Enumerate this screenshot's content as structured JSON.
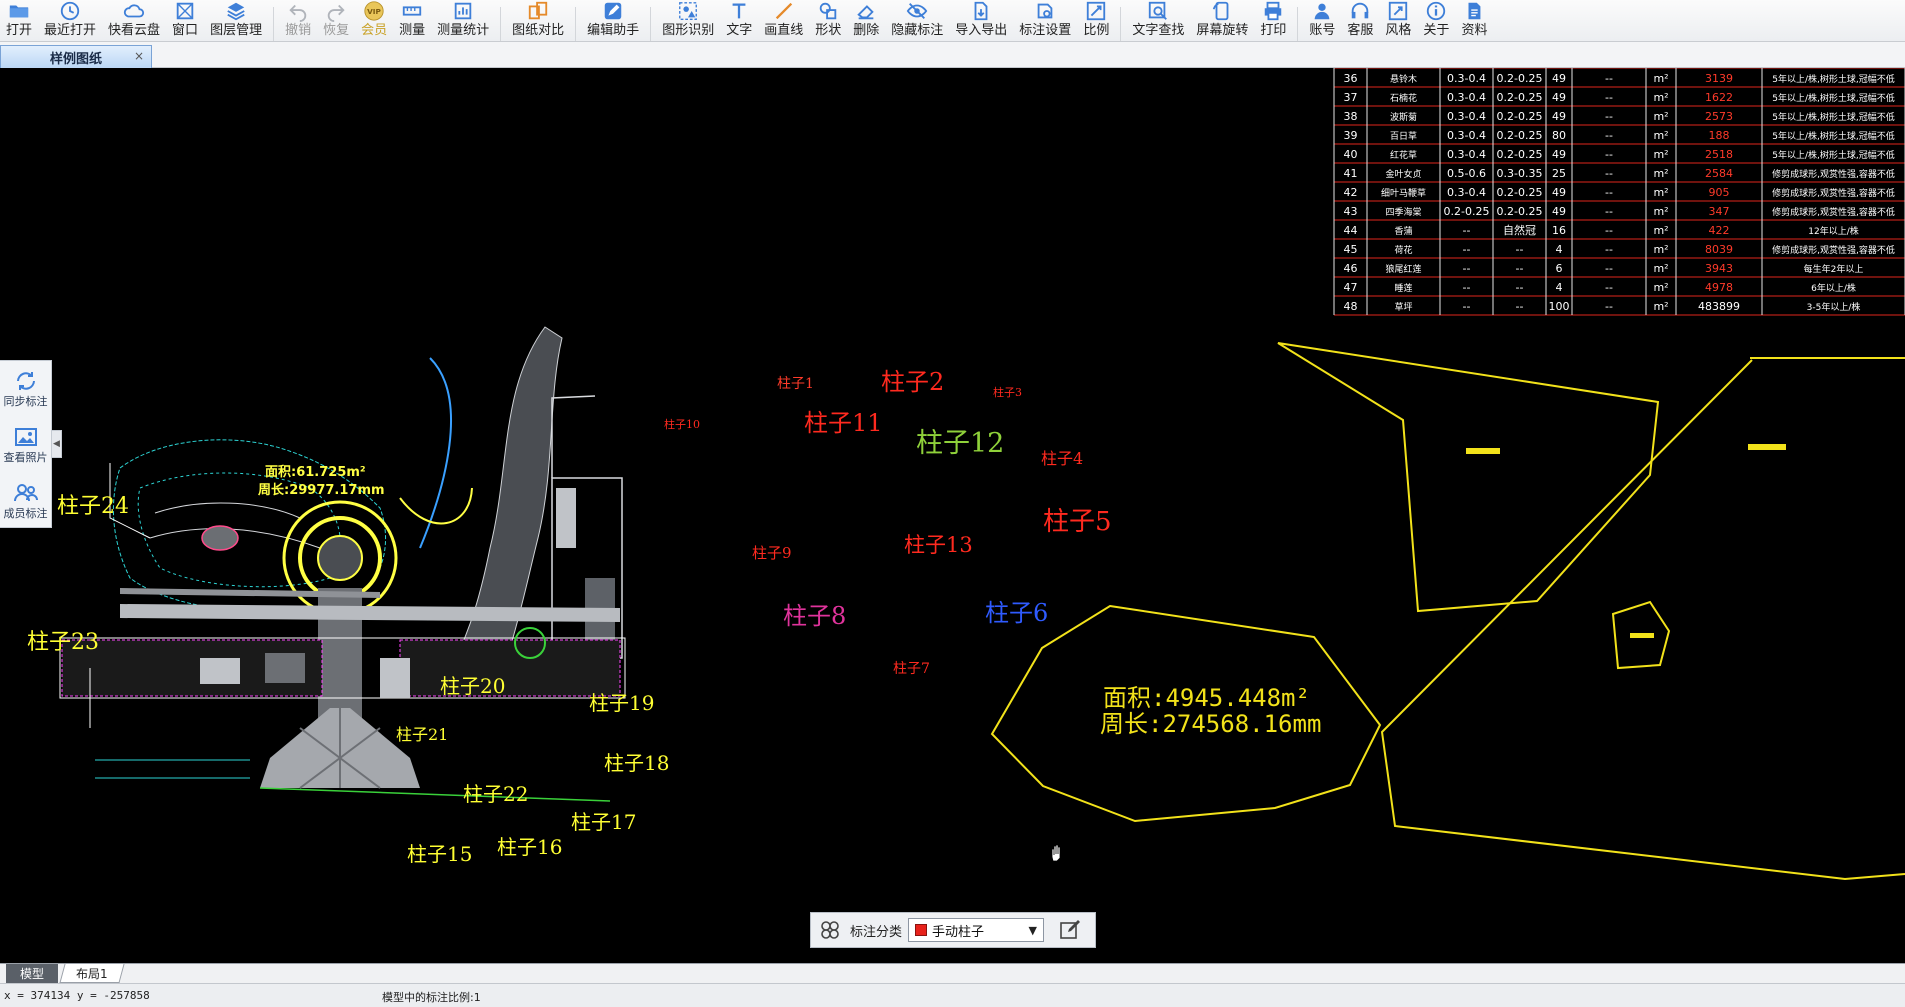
{
  "toolbar": {
    "items": [
      {
        "label": "打开",
        "icon": "folder-icon"
      },
      {
        "label": "最近打开",
        "icon": "clock-icon"
      },
      {
        "label": "快看云盘",
        "icon": "cloud-icon"
      },
      {
        "label": "窗口",
        "icon": "window-icon"
      },
      {
        "label": "图层管理",
        "icon": "layers-icon"
      },
      {
        "label": "撤销",
        "icon": "undo-icon"
      },
      {
        "label": "恢复",
        "icon": "redo-icon"
      },
      {
        "label": "会员",
        "icon": "vip-icon"
      },
      {
        "label": "测量",
        "icon": "ruler-icon"
      },
      {
        "label": "测量统计",
        "icon": "measure-stats-icon"
      },
      {
        "label": "图纸对比",
        "icon": "compare-icon"
      },
      {
        "label": "编辑助手",
        "icon": "edit-assistant-icon"
      },
      {
        "label": "图形识别",
        "icon": "shape-recognition-icon"
      },
      {
        "label": "文字",
        "icon": "text-icon"
      },
      {
        "label": "画直线",
        "icon": "line-icon"
      },
      {
        "label": "形状",
        "icon": "shape-icon"
      },
      {
        "label": "删除",
        "icon": "eraser-icon"
      },
      {
        "label": "隐藏标注",
        "icon": "eye-hide-icon"
      },
      {
        "label": "导入导出",
        "icon": "import-export-icon"
      },
      {
        "label": "标注设置",
        "icon": "annotation-settings-icon"
      },
      {
        "label": "比例",
        "icon": "scale-icon"
      },
      {
        "label": "文字查找",
        "icon": "text-search-icon"
      },
      {
        "label": "屏幕旋转",
        "icon": "rotate-screen-icon"
      },
      {
        "label": "打印",
        "icon": "printer-icon"
      },
      {
        "label": "账号",
        "icon": "user-icon"
      },
      {
        "label": "客服",
        "icon": "headset-icon"
      },
      {
        "label": "风格",
        "icon": "style-icon"
      },
      {
        "label": "关于",
        "icon": "info-icon"
      },
      {
        "label": "资料",
        "icon": "docs-icon"
      }
    ]
  },
  "document_tab": {
    "title": "样例图纸",
    "close": "×"
  },
  "side_panel": {
    "items": [
      {
        "label": "同步标注",
        "icon": "sync-icon"
      },
      {
        "label": "查看照片",
        "icon": "photo-icon"
      },
      {
        "label": "成员标注",
        "icon": "members-icon"
      }
    ],
    "collapse": "◀"
  },
  "plant_table": {
    "rows": [
      {
        "no": "36",
        "name": "悬铃木",
        "d1": "0.3-0.4",
        "d2": "0.2-0.25",
        "n": "49",
        "spec": "--",
        "unit": "m²",
        "qty": "3139",
        "note": "5年以上/株,树形土球,冠幅不低"
      },
      {
        "no": "37",
        "name": "石楠花",
        "d1": "0.3-0.4",
        "d2": "0.2-0.25",
        "n": "49",
        "spec": "--",
        "unit": "m²",
        "qty": "1622",
        "note": "5年以上/株,树形土球,冠幅不低"
      },
      {
        "no": "38",
        "name": "波斯菊",
        "d1": "0.3-0.4",
        "d2": "0.2-0.25",
        "n": "49",
        "spec": "--",
        "unit": "m²",
        "qty": "2573",
        "note": "5年以上/株,树形土球,冠幅不低"
      },
      {
        "no": "39",
        "name": "百日草",
        "d1": "0.3-0.4",
        "d2": "0.2-0.25",
        "n": "80",
        "spec": "--",
        "unit": "m²",
        "qty": "188",
        "note": "5年以上/株,树形土球,冠幅不低"
      },
      {
        "no": "40",
        "name": "红花草",
        "d1": "0.3-0.4",
        "d2": "0.2-0.25",
        "n": "49",
        "spec": "--",
        "unit": "m²",
        "qty": "2518",
        "note": "5年以上/株,树形土球,冠幅不低"
      },
      {
        "no": "41",
        "name": "金叶女贞",
        "d1": "0.5-0.6",
        "d2": "0.3-0.35",
        "n": "25",
        "spec": "--",
        "unit": "m²",
        "qty": "2584",
        "note": "修剪成球形,观赏性强,容器不低"
      },
      {
        "no": "42",
        "name": "细叶马鞭草",
        "d1": "0.3-0.4",
        "d2": "0.2-0.25",
        "n": "49",
        "spec": "--",
        "unit": "m²",
        "qty": "905",
        "note": "修剪成球形,观赏性强,容器不低"
      },
      {
        "no": "43",
        "name": "四季海棠",
        "d1": "0.2-0.25",
        "d2": "0.2-0.25",
        "n": "49",
        "spec": "--",
        "unit": "m²",
        "qty": "347",
        "note": "修剪成球形,观赏性强,容器不低"
      },
      {
        "no": "44",
        "name": "香蒲",
        "d1": "--",
        "d2": "自然冠",
        "n": "16",
        "spec": "--",
        "unit": "m²",
        "qty": "422",
        "note": "12年以上/株"
      },
      {
        "no": "45",
        "name": "荷花",
        "d1": "--",
        "d2": "--",
        "n": "4",
        "spec": "--",
        "unit": "m²",
        "qty": "8039",
        "note": "修剪成球形,观赏性强,容器不低"
      },
      {
        "no": "46",
        "name": "狼尾红莲",
        "d1": "--",
        "d2": "--",
        "n": "6",
        "spec": "--",
        "unit": "m²",
        "qty": "3943",
        "note": "每生年2年以上"
      },
      {
        "no": "47",
        "name": "睡莲",
        "d1": "--",
        "d2": "--",
        "n": "4",
        "spec": "--",
        "unit": "m²",
        "qty": "4978",
        "note": "6年以上/株"
      },
      {
        "no": "48",
        "name": "草坪",
        "d1": "--",
        "d2": "--",
        "n": "100",
        "spec": "--",
        "unit": "m²",
        "qty": "483899",
        "note": "3-5年以上/株"
      }
    ]
  },
  "column_labels": [
    {
      "text": "柱子1",
      "color": "#ff3b2a",
      "size": 14
    },
    {
      "text": "柱子2",
      "color": "#ff2a1f",
      "size": 24
    },
    {
      "text": "柱子3",
      "color": "#ff2a1f",
      "size": 11
    },
    {
      "text": "柱子4",
      "color": "#ff2a1f",
      "size": 16
    },
    {
      "text": "柱子5",
      "color": "#ff2a1f",
      "size": 26
    },
    {
      "text": "柱子6",
      "color": "#2f5bff",
      "size": 24
    },
    {
      "text": "柱子7",
      "color": "#ff2a1f",
      "size": 14
    },
    {
      "text": "柱子8",
      "color": "#e0339c",
      "size": 24
    },
    {
      "text": "柱子9",
      "color": "#ff2a1f",
      "size": 15
    },
    {
      "text": "柱子10",
      "color": "#ff2a1f",
      "size": 11
    },
    {
      "text": "柱子11",
      "color": "#ff2a1f",
      "size": 24
    },
    {
      "text": "柱子12",
      "color": "#8fd13a",
      "size": 27
    },
    {
      "text": "柱子13",
      "color": "#ff2a1f",
      "size": 21
    },
    {
      "text": "柱子24",
      "color": "#ffff33",
      "size": 22
    },
    {
      "text": "柱子23",
      "color": "#ffff33",
      "size": 22
    },
    {
      "text": "柱子20",
      "color": "#ffff33",
      "size": 20
    },
    {
      "text": "柱子19",
      "color": "#ffff33",
      "size": 20
    },
    {
      "text": "柱子21",
      "color": "#ffff33",
      "size": 16
    },
    {
      "text": "柱子18",
      "color": "#ffff33",
      "size": 20
    },
    {
      "text": "柱子22",
      "color": "#ffff33",
      "size": 20
    },
    {
      "text": "柱子17",
      "color": "#ffff33",
      "size": 20
    },
    {
      "text": "柱子15",
      "color": "#ffff33",
      "size": 20
    },
    {
      "text": "柱子16",
      "color": "#ffff33",
      "size": 20
    }
  ],
  "area_annotations": [
    {
      "area": "面积:4945.448m²",
      "perimeter": "周长:274568.16mm"
    },
    {
      "area": "面积:61.725m²",
      "perimeter": "周长:29977.17mm"
    }
  ],
  "annotation_bar": {
    "label": "标注分类",
    "selected": "手动柱子",
    "swatch_color": "#e8221b"
  },
  "layout_tabs": {
    "model": "模型",
    "layout": "布局1"
  },
  "status": {
    "coords": "x = 374134 y = -257858",
    "scale": "模型中的标注比例:1"
  }
}
